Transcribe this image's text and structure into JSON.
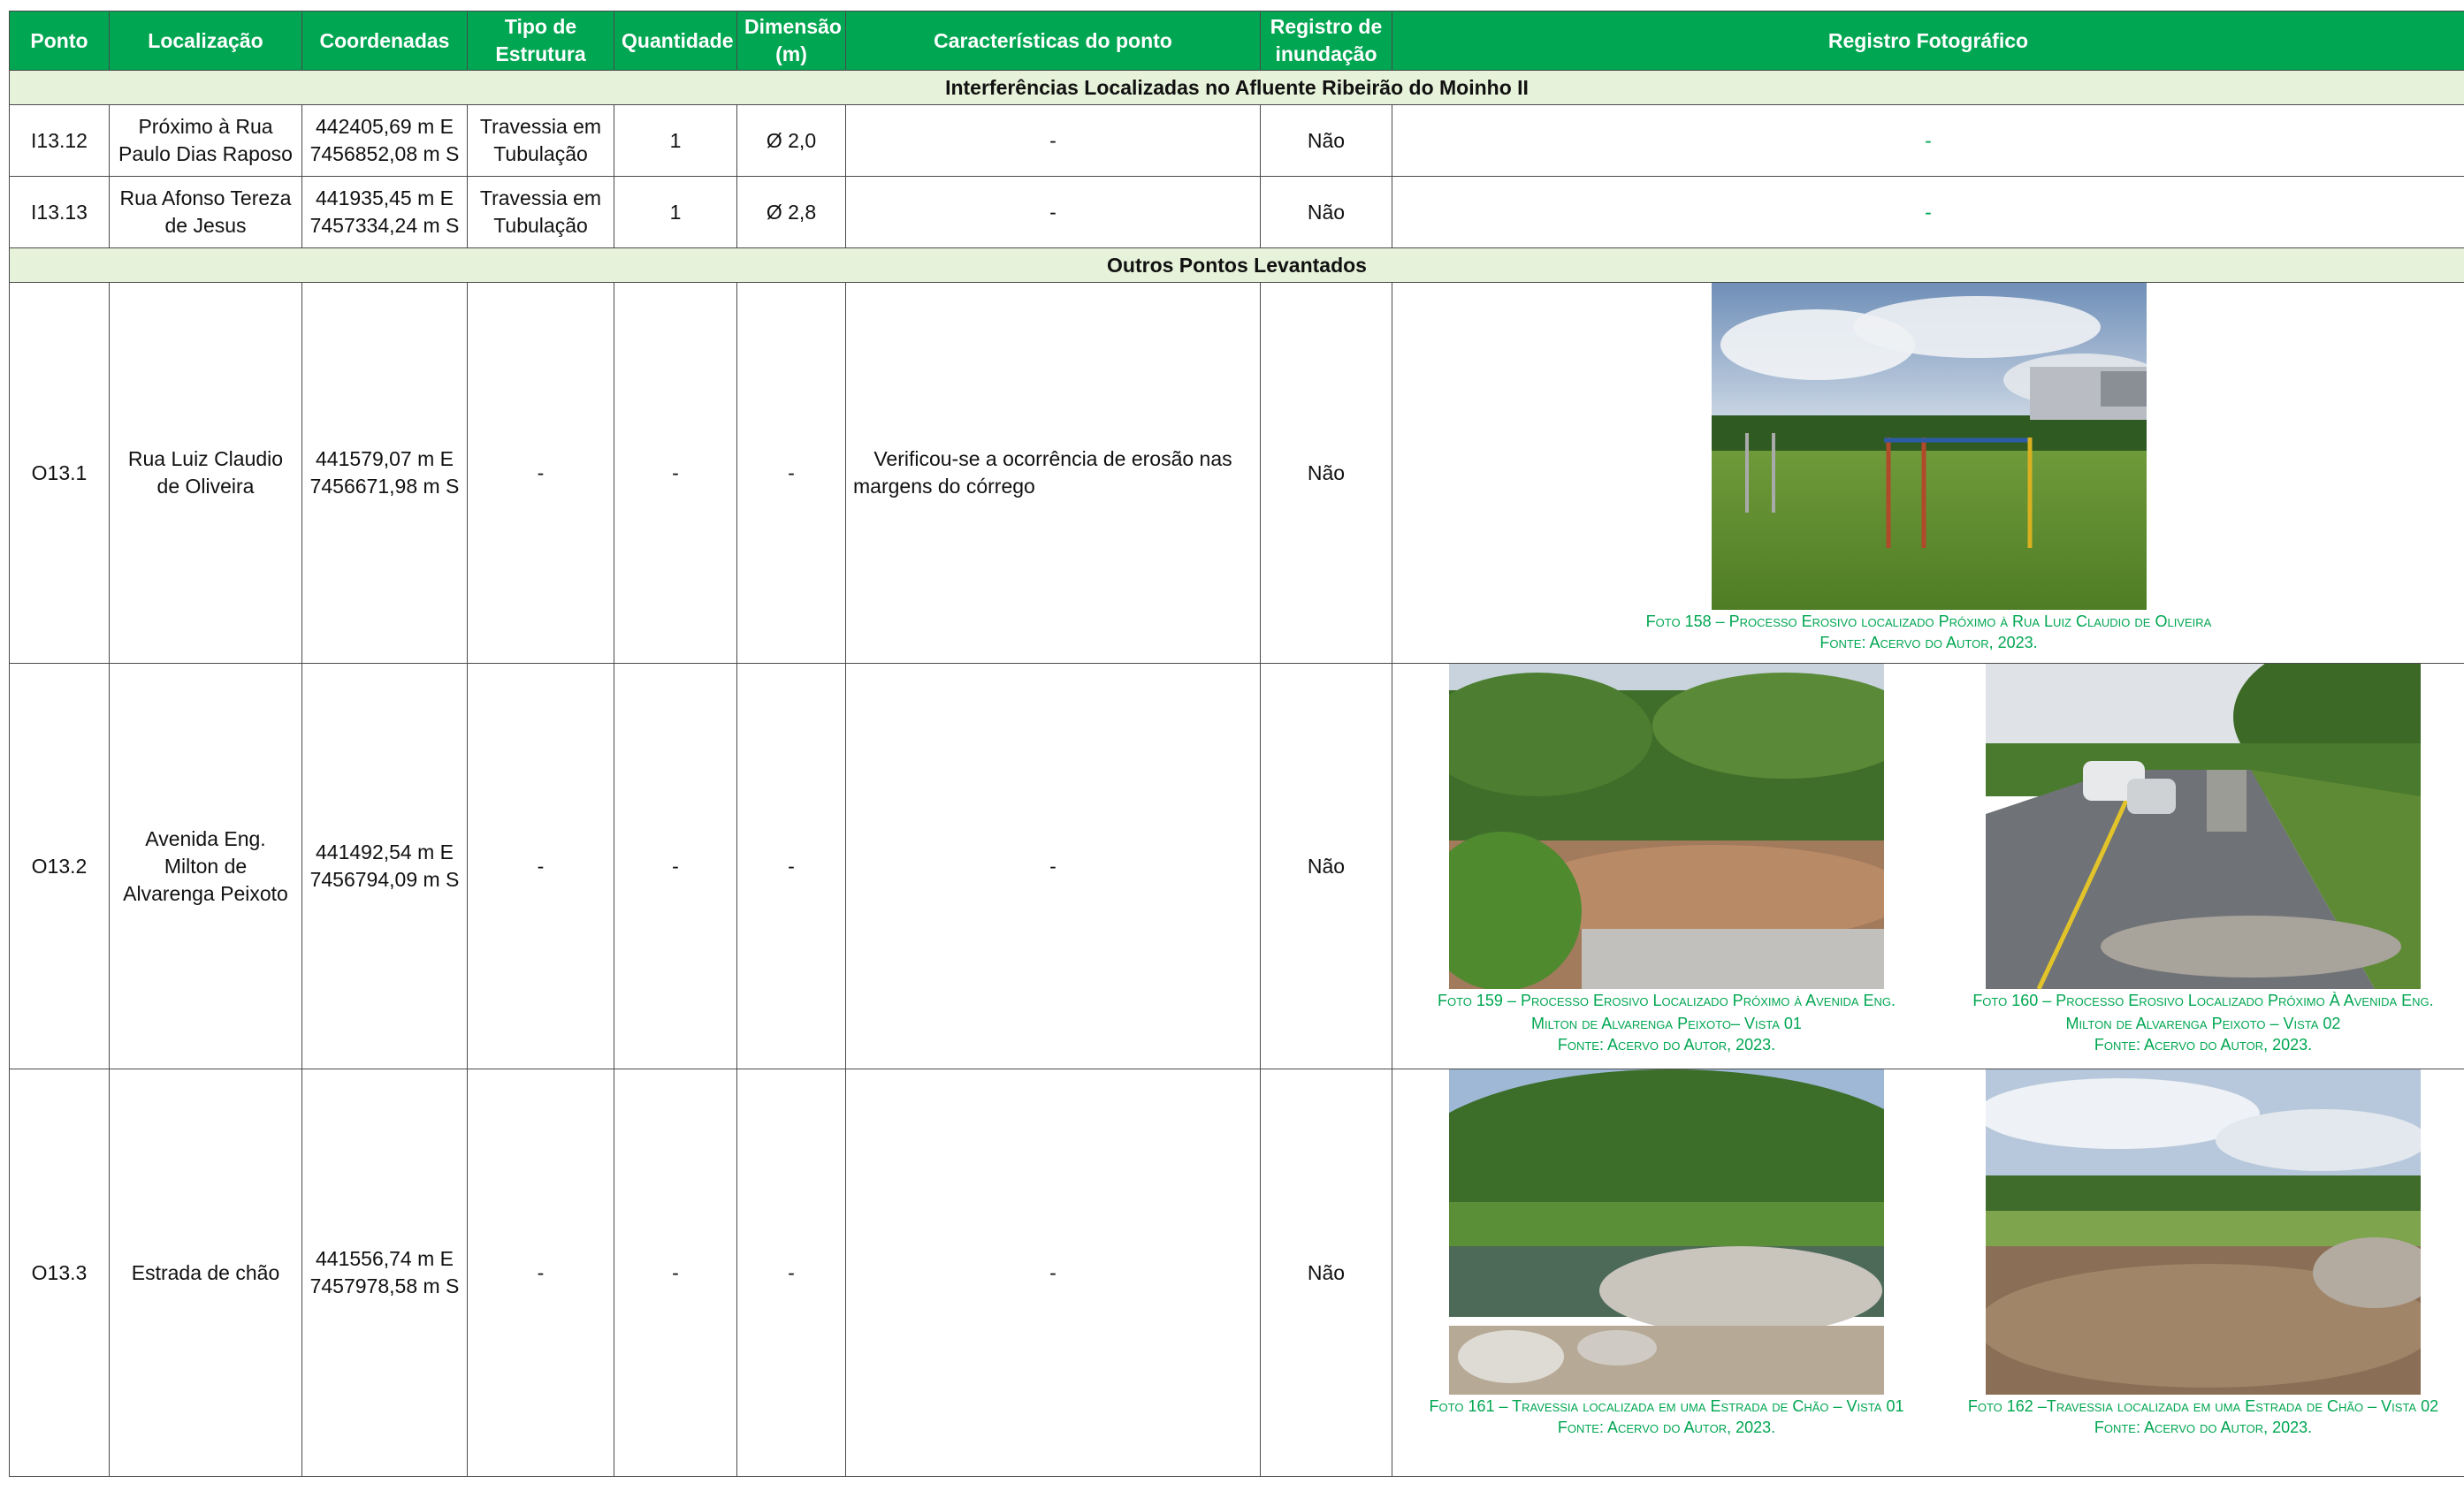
{
  "columns": [
    "Ponto",
    "Localização",
    "Coordenadas",
    "Tipo de Estrutura",
    "Quantidade",
    "Dimensão (m)",
    "Características do ponto",
    "Registro de inundação",
    "Registro Fotográfico"
  ],
  "sections": {
    "interferencias": "Interferências Localizadas no Afluente Ribeirão do Moinho II",
    "outros": "Outros Pontos Levantados"
  },
  "interferences": [
    {
      "ponto": "I13.12",
      "localizacao": "Próximo à Rua Paulo Dias Raposo",
      "coord_e": "442405,69 m E",
      "coord_s": "7456852,08 m S",
      "tipo": "Travessia em Tubulação",
      "quantidade": "1",
      "dimensao": "Ø 2,0",
      "caracteristicas": "-",
      "inundacao": "Não",
      "foto": "-"
    },
    {
      "ponto": "I13.13",
      "localizacao": "Rua Afonso Tereza de Jesus",
      "coord_e": "441935,45 m E",
      "coord_s": "7457334,24 m S",
      "tipo": "Travessia em Tubulação",
      "quantidade": "1",
      "dimensao": "Ø 2,8",
      "caracteristicas": "-",
      "inundacao": "Não",
      "foto": "-"
    }
  ],
  "others": [
    {
      "ponto": "O13.1",
      "localizacao": "Rua Luiz Claudio de Oliveira",
      "coord_e": "441579,07 m E",
      "coord_s": "7456671,98 m S",
      "tipo": "-",
      "quantidade": "-",
      "dimensao": "-",
      "caracteristicas": "Verificou-se a ocorrência de erosão nas margens do córrego",
      "inundacao": "Não",
      "photos": [
        {
          "caption": "Foto 158 – Processo Erosivo localizado Próximo à Rua Luiz Claudio de Oliveira",
          "source": "Fonte: Acervo do Autor, 2023."
        }
      ]
    },
    {
      "ponto": "O13.2",
      "localizacao": "Avenida Eng. Milton de Alvarenga Peixoto",
      "coord_e": "441492,54 m E",
      "coord_s": "7456794,09 m S",
      "tipo": "-",
      "quantidade": "-",
      "dimensao": "-",
      "caracteristicas": "-",
      "inundacao": "Não",
      "photos": [
        {
          "caption": "Foto 159 – Processo Erosivo Localizado Próximo à Avenida Eng. Milton de Alvarenga Peixoto– Vista 01",
          "source": "Fonte: Acervo do Autor, 2023."
        },
        {
          "caption": "Foto 160 – Processo Erosivo Localizado Próximo À Avenida Eng. Milton de Alvarenga Peixoto – Vista 02",
          "source": "Fonte: Acervo do Autor, 2023."
        }
      ]
    },
    {
      "ponto": "O13.3",
      "localizacao": "Estrada de chão",
      "coord_e": "441556,74 m E",
      "coord_s": "7457978,58 m S",
      "tipo": "-",
      "quantidade": "-",
      "dimensao": "-",
      "caracteristicas": "-",
      "inundacao": "Não",
      "photos": [
        {
          "caption": "Foto 161 – Travessia localizada em uma Estrada de Chão – Vista 01",
          "source": "Fonte: Acervo do Autor, 2023."
        },
        {
          "caption": "Foto 162 –Travessia localizada em uma Estrada de Chão – Vista 02",
          "source": "Fonte: Acervo do Autor, 2023."
        }
      ]
    }
  ],
  "colors": {
    "header_green": "#00a651",
    "section_bg": "#e6f2d9",
    "caption_green": "#00a651"
  }
}
